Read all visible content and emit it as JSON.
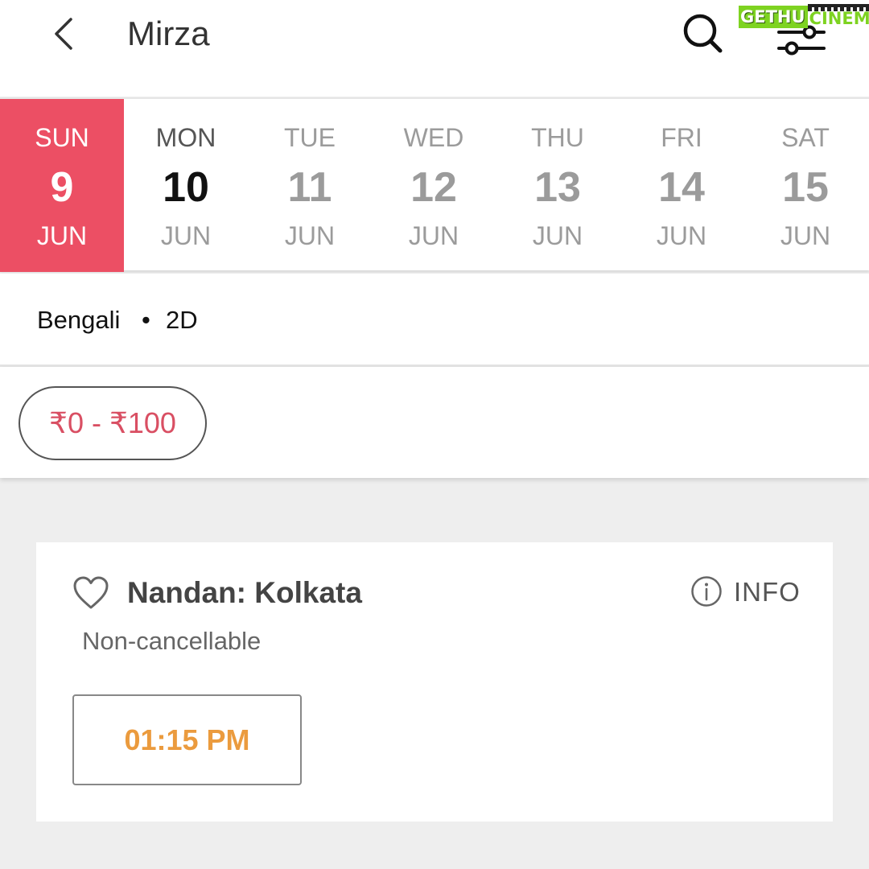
{
  "header": {
    "title": "Mirza",
    "watermark": "GETHU CINEMA",
    "watermark_left": "GETHU",
    "watermark_right": "CINEMA"
  },
  "dates": [
    {
      "dow": "SUN",
      "day": "9",
      "month": "JUN",
      "state": "selected"
    },
    {
      "dow": "MON",
      "day": "10",
      "month": "JUN",
      "state": "next"
    },
    {
      "dow": "TUE",
      "day": "11",
      "month": "JUN",
      "state": "normal"
    },
    {
      "dow": "WED",
      "day": "12",
      "month": "JUN",
      "state": "normal"
    },
    {
      "dow": "THU",
      "day": "13",
      "month": "JUN",
      "state": "normal"
    },
    {
      "dow": "FRI",
      "day": "14",
      "month": "JUN",
      "state": "normal"
    },
    {
      "dow": "SAT",
      "day": "15",
      "month": "JUN",
      "state": "normal"
    }
  ],
  "language_bar": {
    "language": "Bengali",
    "separator": "•",
    "format": "2D"
  },
  "price_filter": {
    "label": "₹0 - ₹100"
  },
  "venue": {
    "name": "Nandan: Kolkata",
    "info_label": "INFO",
    "note": "Non-cancellable",
    "showtimes": [
      "01:15 PM"
    ]
  },
  "icons": {
    "back": "chevron-left-icon",
    "search": "search-icon",
    "filter": "sliders-icon",
    "favorite": "heart-outline-icon",
    "info": "info-circle-icon"
  },
  "colors": {
    "accent": "#ec4f64",
    "price_text": "#d94f63",
    "showtime_text": "#eb9b3e",
    "background": "#eeeeee",
    "watermark_green": "#7ed321"
  }
}
